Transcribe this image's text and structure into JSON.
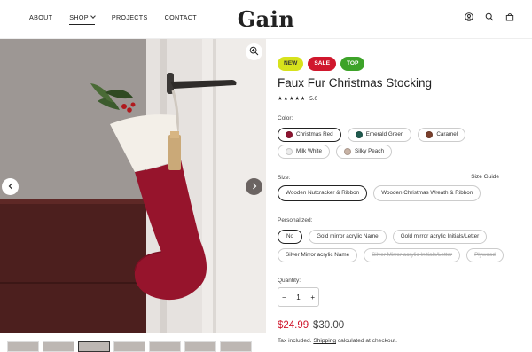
{
  "header": {
    "nav": [
      {
        "label": "ABOUT"
      },
      {
        "label": "SHOP"
      },
      {
        "label": "PROJECTS"
      },
      {
        "label": "CONTACT"
      }
    ],
    "logo": "Gain",
    "icons": [
      "user-icon",
      "search-icon",
      "cart-icon"
    ]
  },
  "gallery": {
    "icons": [
      "zoom-in-icon",
      "chevron-left-icon",
      "chevron-right-icon"
    ],
    "thumbnail_count": 7,
    "active_thumbnail": 3
  },
  "product": {
    "badges": {
      "new": "NEW",
      "sale": "SALE",
      "top": "TOP"
    },
    "title": "Faux Fur Christmas Stocking",
    "stars": "★★★★★",
    "rating": "5.0",
    "color_label": "Color:",
    "colors": [
      {
        "label": "Christmas Red",
        "swatch": "#8e1430",
        "selected": true
      },
      {
        "label": "Emerald Green",
        "swatch": "#1f5a4e"
      },
      {
        "label": "Caramel",
        "swatch": "#7a3f2c"
      },
      {
        "label": "Milk White",
        "swatch": "#ececec"
      },
      {
        "label": "Silky Peach",
        "swatch": "#c8b3a5"
      }
    ],
    "size_label": "Size:",
    "size_guide": "Size Guide",
    "sizes": [
      {
        "label": "Wooden Nutcracker & Ribbon",
        "selected": true
      },
      {
        "label": "Wooden Christmas Wreath & Ribbon"
      }
    ],
    "personalized_label": "Personalized:",
    "personalized": [
      {
        "label": "No",
        "selected": true
      },
      {
        "label": "Gold mirror acrylic Name"
      },
      {
        "label": "Gold mirror acrylic Initials/Letter"
      },
      {
        "label": "Silver Mirror acrylic Name"
      },
      {
        "label": "Silver Mirror acrylic Initials/Letter",
        "disabled": true
      },
      {
        "label": "Plywood",
        "disabled": true
      }
    ],
    "quantity_label": "Quantity:",
    "quantity": {
      "minus": "−",
      "value": "1",
      "plus": "+"
    },
    "price": "$24.99",
    "compare_price": "$30.00",
    "tax_note": {
      "before": "Tax included. ",
      "link": "Shipping",
      "after": " calculated at checkout."
    }
  },
  "colors": {
    "sale": "#d0172d",
    "new": "#d7e21c",
    "top": "#3da329"
  }
}
